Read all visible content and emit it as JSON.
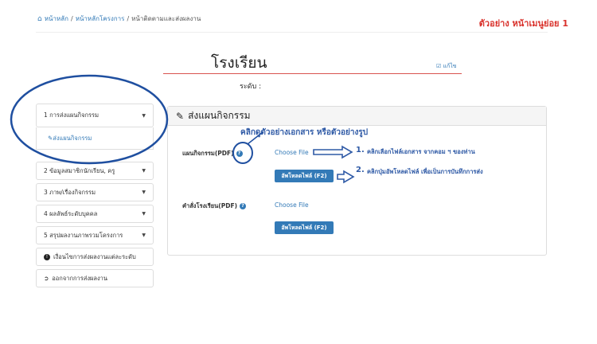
{
  "breadcrumb": {
    "items": [
      "หน้าหลัก",
      "หน้าหลักโครงการ",
      "หน้าติดตามและส่งผลงาน"
    ],
    "sep": "/"
  },
  "sample_label": "ตัวอย่าง หน้าเมนูย่อย 1",
  "school": {
    "title": "โรงเรียน",
    "edit": "แก้ไข",
    "level_label": "ระดับ :"
  },
  "sidebar": {
    "items": [
      {
        "label": "1 การส่งแผนกิจกรรม",
        "sub": "ส่งแผนกิจกรรม"
      },
      {
        "label": "2 ข้อมูลสมาชิกนักเรียน, ครู"
      },
      {
        "label": "3 ภาพ/เรื่องกิจกรรม"
      },
      {
        "label": "4 ผลลัพธ์ระดับบุคคล"
      },
      {
        "label": "5 สรุปผลงานภาพรวมโครงการ"
      },
      {
        "label": "เงื่อนไขการส่งผลงานแต่ละระดับ"
      },
      {
        "label": "ออกจากการส่งผลงาน"
      }
    ]
  },
  "panel": {
    "title": "ส่งแผนกิจกรรม",
    "fields": [
      {
        "label": "แผนกิจกรรม(PDF)",
        "choose": "Choose File",
        "button": "อัพโหลดไฟล์ (F2)"
      },
      {
        "label": "คำสั่งโรงเรียน(PDF)",
        "choose": "Choose File",
        "button": "อัพโหลดไฟล์ (F2)"
      }
    ]
  },
  "annotations": {
    "sample_hint": "คลิกดูตัวอย่างเอกสาร หรือตัวอย่างรูป",
    "step1_num": "1.",
    "step1": "คลิกเลือกไฟล์เอกสาร จากคอม ฯ ของท่าน",
    "step2_num": "2.",
    "step2": "คลิกปุ่มอัพโหลดไฟล์ เพื่อเป็นการบันทึกการส่ง"
  },
  "colors": {
    "accent": "#337ab7",
    "sample_red": "#d9312b",
    "annotation_blue": "#2f5aa6",
    "circle_blue": "#1f4fa0"
  }
}
